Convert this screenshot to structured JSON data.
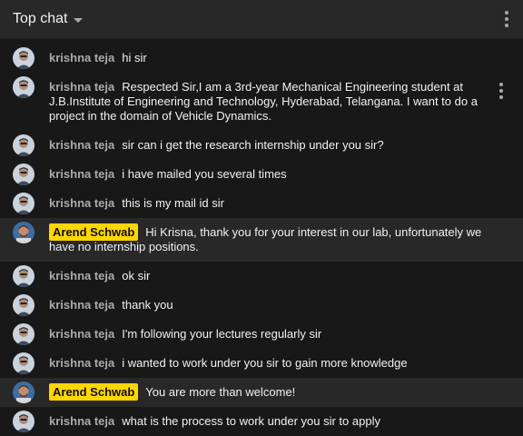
{
  "header": {
    "title": "Top chat"
  },
  "messages": [
    {
      "author": "krishna teja",
      "text": "hi sir",
      "owner": false
    },
    {
      "author": "krishna teja",
      "text": "Respected Sir,I am a 3rd-year Mechanical Engineering student at J.B.Institute of Engineering and Technology, Hyderabad, Telangana. I want to do a project in the domain of Vehicle Dynamics.",
      "owner": false
    },
    {
      "author": "krishna teja",
      "text": "sir can i get the research internship under you sir?",
      "owner": false
    },
    {
      "author": "krishna teja",
      "text": "i have mailed you several times",
      "owner": false
    },
    {
      "author": "krishna teja",
      "text": "this is my mail id sir",
      "owner": false
    },
    {
      "author": "Arend Schwab",
      "text": "Hi Krisna, thank you for your interest in our lab, unfortunately we have no internship positions.",
      "owner": true
    },
    {
      "author": "krishna teja",
      "text": "ok sir",
      "owner": false
    },
    {
      "author": "krishna teja",
      "text": "thank you",
      "owner": false
    },
    {
      "author": "krishna teja",
      "text": "I'm following your lectures regularly sir",
      "owner": false
    },
    {
      "author": "krishna teja",
      "text": "i wanted to work under you sir to gain more knowledge",
      "owner": false
    },
    {
      "author": "Arend Schwab",
      "text": "You are more than welcome!",
      "owner": true
    },
    {
      "author": "krishna teja",
      "text": "what is the process to work under you sir to apply",
      "owner": false
    }
  ],
  "colors": {
    "background": "#181818",
    "header": "#282828",
    "owner_badge": "#ffd600",
    "author_text": "#aaaaaa"
  }
}
